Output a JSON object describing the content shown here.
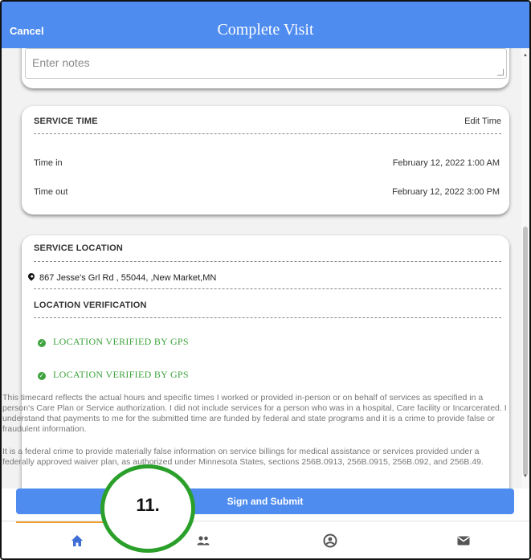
{
  "header": {
    "cancel_label": "Cancel",
    "title": "Complete Visit"
  },
  "notes": {
    "placeholder": "Enter notes"
  },
  "service_time": {
    "heading": "SERVICE TIME",
    "edit_label": "Edit Time",
    "time_in_label": "Time in",
    "time_in_value": "February 12, 2022 1:00 AM",
    "time_out_label": "Time out",
    "time_out_value": "February 12, 2022 3:00 PM"
  },
  "service_location": {
    "heading": "SERVICE LOCATION",
    "address": "867 Jesse's Grl Rd , 55044, ,New Market,MN",
    "verification_heading": "LOCATION VERIFICATION",
    "verified_1": "LOCATION VERIFIED BY GPS",
    "verified_2": "LOCATION VERIFIED BY GPS"
  },
  "legal": {
    "paragraph_1": "This timecard reflects the actual hours and specific times I worked or provided in-person or on behalf of services as specified in a person's Care Plan or Service authorization. I did not include services for a person who was in a hospital, Care facility or Incarcerated. I understand that payments to me for the submitted time are funded by federal and state programs and it is a crime to provide false or fraudulent information.",
    "paragraph_2": "It is a federal crime to provide materially false information on service billings for medical assistance or services provided under a federally approved waiver plan, as authorized under Minnesota States, sections 256B.0913, 256B.0915, 256B.092, and 256B.49."
  },
  "submit_label": "Sign and Submit",
  "annotation_label": "11.",
  "nav": {
    "items": [
      "home-icon",
      "people-icon",
      "account-icon",
      "mail-icon"
    ],
    "active": "home-icon"
  },
  "colors": {
    "brand_blue": "#4f8cf0",
    "verified_green": "#3ea33e",
    "annotation_green": "#2aa02a",
    "nav_indicator": "#f0a030",
    "nav_icon": "#3d6fd6"
  }
}
